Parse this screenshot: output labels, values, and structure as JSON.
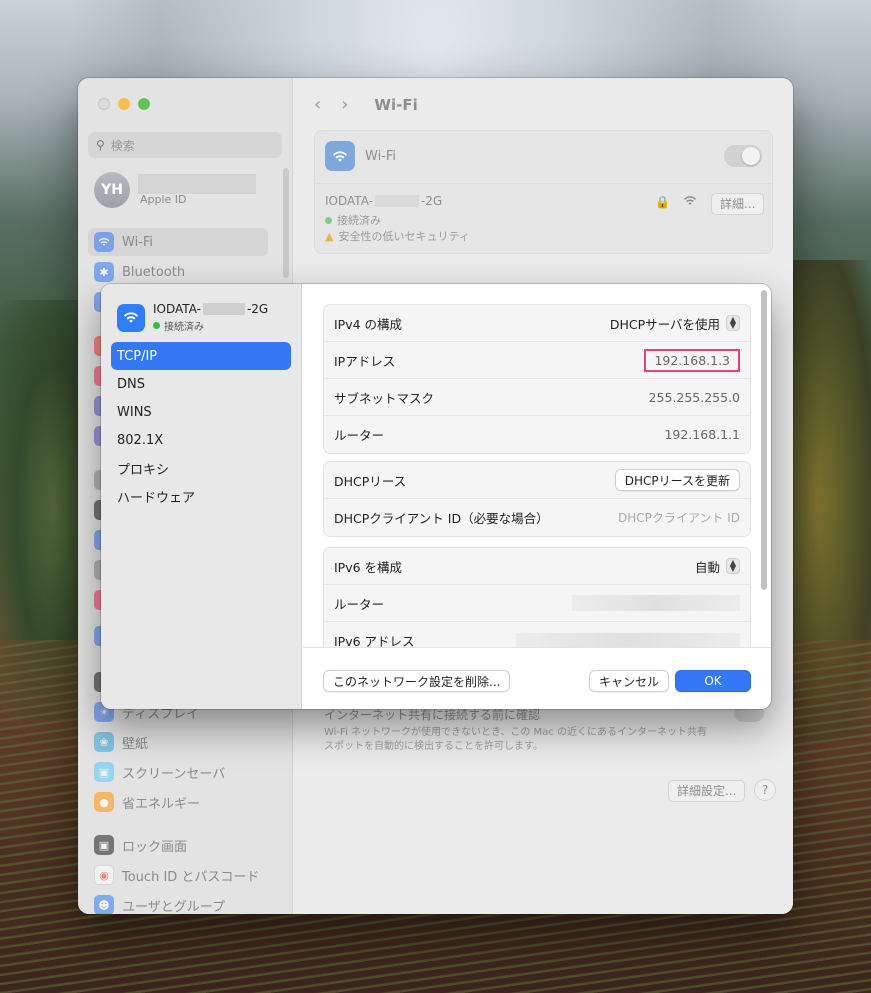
{
  "window": {
    "search_placeholder": "検索",
    "apple_id": {
      "initials": "YH",
      "sub": "Apple ID"
    },
    "sidebar_top": [
      {
        "label": "Wi-Fi",
        "icon": "wifi-icon",
        "selected": true
      },
      {
        "label": "Bluetooth",
        "icon": "bluetooth-icon",
        "selected": false
      }
    ],
    "sidebar_bottom": [
      {
        "label": "ディスプレイ",
        "icon": "display-icon"
      },
      {
        "label": "壁紙",
        "icon": "wallpaper-icon"
      },
      {
        "label": "スクリーンセーバ",
        "icon": "screensaver-icon"
      },
      {
        "label": "省エネルギー",
        "icon": "energy-icon"
      },
      {
        "label": "ロック画面",
        "icon": "lock-icon"
      },
      {
        "label": "Touch ID とパスコード",
        "icon": "fingerprint-icon"
      },
      {
        "label": "ユーザとグループ",
        "icon": "users-icon"
      }
    ],
    "nav_title": "Wi-Fi",
    "wifi_card_label": "Wi-Fi",
    "network": {
      "name_prefix": "IODATA-",
      "name_suffix": "-2G",
      "status": "接続済み",
      "warning": "安全性の低いセキュリティ",
      "details_button": "詳細..."
    },
    "hotspot": {
      "title": "インターネット共有に接続する前に確認",
      "desc_line1": "Wi-Fi ネットワークが使用できないとき、この Mac の近くにあるインターネット共有",
      "desc_line2": "スポットを自動的に検出することを許可します。"
    },
    "advanced_button": "詳細設定...",
    "help_button": "?"
  },
  "sheet": {
    "network_name_prefix": "IODATA-",
    "network_name_suffix": "-2G",
    "network_status": "接続済み",
    "tabs": [
      "TCP/IP",
      "DNS",
      "WINS",
      "802.1X",
      "プロキシ",
      "ハードウェア"
    ],
    "ipv4": {
      "config_label": "IPv4 の構成",
      "config_value": "DHCPサーバを使用",
      "ip_label": "IPアドレス",
      "ip_value": "192.168.1.3",
      "subnet_label": "サブネットマスク",
      "subnet_value": "255.255.255.0",
      "router_label": "ルーター",
      "router_value": "192.168.1.1"
    },
    "dhcp": {
      "lease_label": "DHCPリース",
      "renew_button": "DHCPリースを更新",
      "client_id_label": "DHCPクライアント ID（必要な場合）",
      "client_id_placeholder": "DHCPクライアント ID"
    },
    "ipv6": {
      "config_label": "IPv6 を構成",
      "config_value": "自動",
      "router_label": "ルーター",
      "address_label": "IPv6 アドレス"
    },
    "footer": {
      "delete_button": "このネットワーク設定を削除...",
      "cancel_button": "キャンセル",
      "ok_button": "OK"
    }
  },
  "colors": {
    "accent": "#3478f6",
    "highlight_border": "#e1467c",
    "status_green": "#2fbf47"
  }
}
